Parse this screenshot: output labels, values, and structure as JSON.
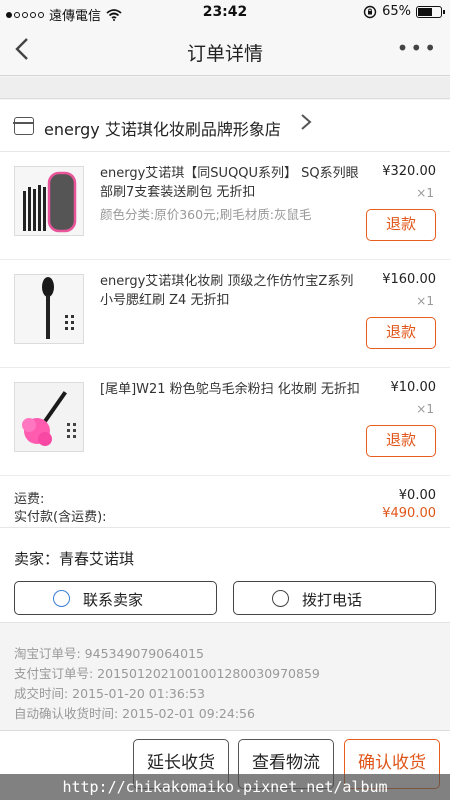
{
  "status_bar": {
    "carrier": "遠傳電信",
    "time": "23:42",
    "battery": "65%",
    "battery_level": 0.65
  },
  "nav": {
    "title": "订单详情",
    "back_icon": "chevron-left-icon",
    "more_icon": "more-dots-icon"
  },
  "shop": {
    "name": "energy 艾诺琪化妆刷品牌形象店"
  },
  "items": [
    {
      "title": "energy艾诺琪【同SUQQU系列】 SQ系列眼部刷7支套装送刷包 无折扣",
      "spec": "颜色分类:原价360元;刷毛材质:灰鼠毛",
      "price": "¥320.00",
      "qty": "×1",
      "refund": "退款"
    },
    {
      "title": "energy艾诺琪化妆刷 顶级之作仿竹宝Z系列 小号腮红刷 Z4 无折扣",
      "spec": "",
      "price": "¥160.00",
      "qty": "×1",
      "refund": "退款"
    },
    {
      "title": "[尾单]W21 粉色鸵鸟毛余粉扫 化妆刷 无折扣",
      "spec": "",
      "price": "¥10.00",
      "qty": "×1",
      "refund": "退款"
    }
  ],
  "totals": {
    "shipping_label": "运费:",
    "shipping_value": "¥0.00",
    "paid_label": "实付款(含运费):",
    "paid_value": "¥490.00"
  },
  "seller": {
    "label": "卖家：青春艾诺琪",
    "contact": "联系卖家",
    "call": "拨打电话"
  },
  "order_info": {
    "taobao_no": "淘宝订单号: 945349079064015",
    "alipay_no": "支付宝订单号: 2015012021001001280030970859",
    "deal_time": "成交时间: 2015-01-20 01:36:53",
    "auto_confirm": "自动确认收货时间: 2015-02-01 09:24:56"
  },
  "bottom_actions": {
    "extend": "延长收货",
    "logistics": "查看物流",
    "confirm": "确认收货"
  },
  "watermark": "http://chikakomaiko.pixnet.net/album",
  "colors": {
    "accent": "#e0561a",
    "text": "#333333",
    "muted": "#999999"
  }
}
